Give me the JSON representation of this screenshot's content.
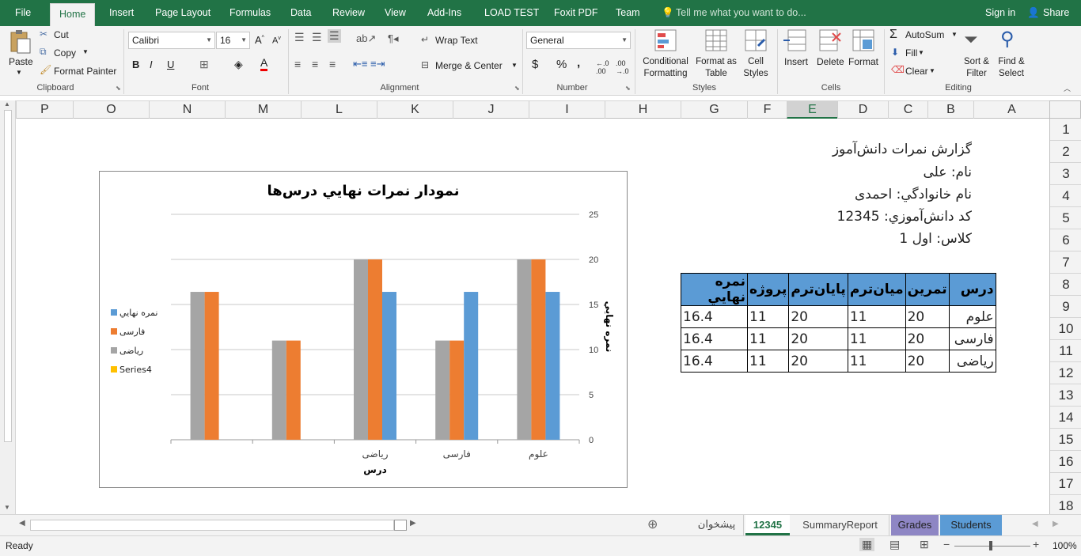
{
  "ribbon_tabs": [
    "File",
    "Home",
    "Insert",
    "Page Layout",
    "Formulas",
    "Data",
    "Review",
    "View",
    "Add-Ins",
    "LOAD TEST",
    "Foxit PDF",
    "Team"
  ],
  "tell_me": "Tell me what you want to do...",
  "sign_in": "Sign in",
  "share": "Share",
  "clipboard": {
    "paste": "Paste",
    "cut": "Cut",
    "copy": "Copy",
    "format_painter": "Format Painter",
    "label": "Clipboard"
  },
  "font": {
    "name": "Calibri",
    "size": "16",
    "label": "Font",
    "bold": "B",
    "italic": "I",
    "underline": "U"
  },
  "alignment": {
    "wrap": "Wrap Text",
    "merge": "Merge & Center",
    "label": "Alignment"
  },
  "number": {
    "format": "General",
    "currency": "$",
    "percent": "%",
    "comma": ",",
    "label": "Number"
  },
  "styles": {
    "conditional": "Conditional Formatting",
    "format_table": "Format as Table",
    "cell_styles": "Cell Styles",
    "label": "Styles"
  },
  "cells": {
    "insert": "Insert",
    "delete": "Delete",
    "format": "Format",
    "label": "Cells"
  },
  "editing": {
    "autosum": "AutoSum",
    "fill": "Fill",
    "clear": "Clear",
    "sort": "Sort & Filter",
    "find": "Find & Select",
    "label": "Editing"
  },
  "columns": [
    "P",
    "O",
    "N",
    "M",
    "L",
    "K",
    "J",
    "I",
    "H",
    "G",
    "F",
    "E",
    "D",
    "C",
    "B",
    "A"
  ],
  "rows": [
    "1",
    "2",
    "3",
    "4",
    "5",
    "6",
    "7",
    "8",
    "9",
    "10",
    "11",
    "12",
    "13",
    "14",
    "15",
    "16",
    "17",
    "18"
  ],
  "report": {
    "title": "گزارش نمرات دانش‌آموز",
    "name": "نام: علی",
    "family": "نام خانوادگي: احمدی",
    "code": "كد دانش‌آموزي: 12345",
    "class": "كلاس: اول 1"
  },
  "grades_table": {
    "headers": [
      "درس",
      "تمرين",
      "ميان‌ترم",
      "پايان‌ترم",
      "پروژه",
      "نمره نهايي"
    ],
    "rows": [
      [
        "علوم",
        "20",
        "11",
        "20",
        "11",
        "16.4"
      ],
      [
        "فارسی",
        "20",
        "11",
        "20",
        "11",
        "16.4"
      ],
      [
        "رياضی",
        "20",
        "11",
        "20",
        "11",
        "16.4"
      ]
    ]
  },
  "chart_data": {
    "type": "bar",
    "title": "نمودار نمرات نهايي درس‌ها",
    "xlabel": "درس",
    "ylabel": "نمره نهايي",
    "ylim": [
      0,
      25
    ],
    "yticks": [
      "0",
      "5",
      "10",
      "15",
      "20",
      "25"
    ],
    "categories": [
      "علوم",
      "فارسی",
      "رياضی",
      "",
      ""
    ],
    "series": [
      {
        "name": "نمره نهايي",
        "color": "#5b9bd5",
        "values": [
          16.4,
          16.4,
          16.4,
          null,
          null
        ]
      },
      {
        "name": "فارسی",
        "color": "#ed7d31",
        "values": [
          20,
          11,
          20,
          11,
          16.4
        ]
      },
      {
        "name": "رياضی",
        "color": "#a5a5a5",
        "values": [
          20,
          11,
          20,
          11,
          16.4
        ]
      },
      {
        "name": "Series4",
        "color": "#ffc000",
        "values": [
          null,
          null,
          null,
          null,
          null
        ]
      }
    ]
  },
  "sheet_tabs": [
    "پيشخوان",
    "12345",
    "SummaryReport",
    "Grades",
    "Students"
  ],
  "status": {
    "ready": "Ready",
    "zoom": "100%"
  }
}
